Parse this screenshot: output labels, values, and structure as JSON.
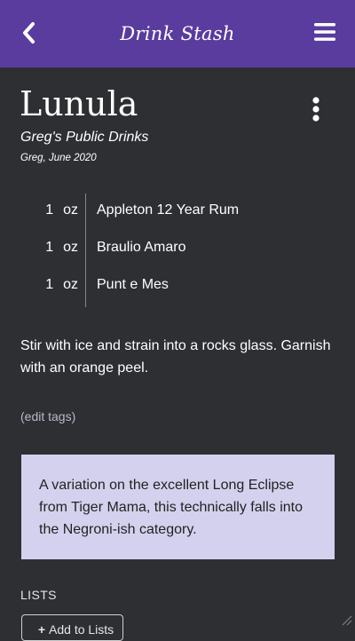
{
  "header": {
    "app_title": "Drink Stash",
    "back_icon": "chevron-left-icon",
    "menu_icon": "hamburger-menu-icon",
    "background_color": "#5a3b9e"
  },
  "drink": {
    "title": "Lunula",
    "list_name": "Greg's Public Drinks",
    "byline": "Greg, June 2020",
    "more_icon": "vertical-dots-icon",
    "ingredients": [
      {
        "qty": "1",
        "unit": "oz",
        "name": "Appleton 12 Year Rum"
      },
      {
        "qty": "1",
        "unit": "oz",
        "name": "Braulio Amaro"
      },
      {
        "qty": "1",
        "unit": "oz",
        "name": "Punt e Mes"
      }
    ],
    "instructions": "Stir with ice and strain into a rocks glass. Garnish with an orange peel.",
    "edit_tags_label": "(edit tags)",
    "note": "A variation on the excellent Long Eclipse from Tiger Mama, this technically falls into the Negroni-ish category.",
    "note_background": "#d4d1ee"
  },
  "lists": {
    "heading": "LISTS",
    "add_button_label": "Add to Lists",
    "add_icon": "plus-icon"
  }
}
